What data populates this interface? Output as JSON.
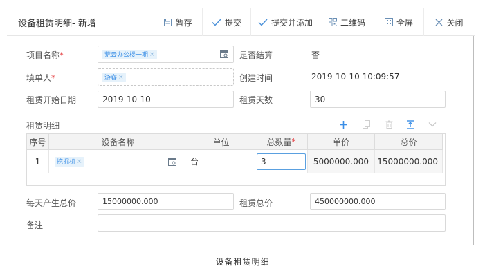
{
  "toolbar": {
    "title": "设备租赁明细- 新增",
    "save": "暂存",
    "submit": "提交",
    "submit_add": "提交并添加",
    "qrcode": "二维码",
    "fullscreen": "全屏",
    "close": "关闭"
  },
  "form": {
    "project_label": "项目名称",
    "project_tag": "荒云办公楼一期",
    "settled_label": "是否结算",
    "settled_value": "否",
    "filler_label": "填单人",
    "filler_tag": "游客",
    "created_label": "创建时间",
    "created_value": "2019-10-10 10:09:57",
    "start_label": "租赁开始日期",
    "start_value": "2019-10-10",
    "days_label": "租赁天数",
    "days_value": "30",
    "detail_label": "租赁明细",
    "daily_total_label": "每天产生总价",
    "daily_total_value": "15000000.000",
    "lease_total_label": "租赁总价",
    "lease_total_value": "450000000.000",
    "remark_label": "备注",
    "remark_value": "",
    "required_mark": "*"
  },
  "grid": {
    "columns": [
      "序号",
      "设备名称",
      "单位",
      "总数量",
      "单价",
      "总价"
    ],
    "rows": [
      {
        "index": "1",
        "equipment_tag": "挖掘机",
        "unit": "台",
        "quantity": "3",
        "unit_price": "5000000.000",
        "total_price": "15000000.000"
      }
    ]
  },
  "caption": "设备租赁明细",
  "colors": {
    "accent": "#3a8ee6",
    "required": "#e4393c"
  }
}
